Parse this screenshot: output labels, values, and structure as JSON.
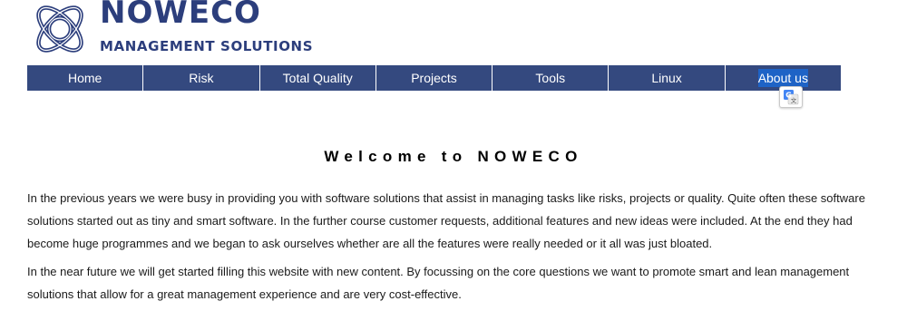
{
  "header": {
    "brand_name": "NOWECO",
    "tagline": "MANAGEMENT SOLUTIONS",
    "logo_icon": "celtic-knot-logo",
    "brand_color": "#2c3e7c"
  },
  "nav": {
    "background": "#34497f",
    "items": [
      {
        "label": "Home"
      },
      {
        "label": "Risk"
      },
      {
        "label": "Total Quality"
      },
      {
        "label": "Projects"
      },
      {
        "label": "Tools"
      },
      {
        "label": "Linux"
      },
      {
        "label": "About us",
        "highlighted": true
      }
    ]
  },
  "translate_widget": {
    "icon": "google-translate-icon"
  },
  "main": {
    "title": "Welcome to NOWECO",
    "paragraphs": [
      "In the previous years we were busy in providing you with software solutions that assist in managing tasks like risks, projects or quality. Quite often these software solutions started out as tiny and smart software. In the further course customer requests, additional features and new ideas were included. At the end they had become huge programmes and we began to ask ourselves whether are all the features were really needed or it all was just bloated.",
      "In the near future we will get started filling this website with new content. By focussing on the core questions we want to promote smart and lean management solutions that allow for a great management experience and are very cost-effective."
    ]
  }
}
